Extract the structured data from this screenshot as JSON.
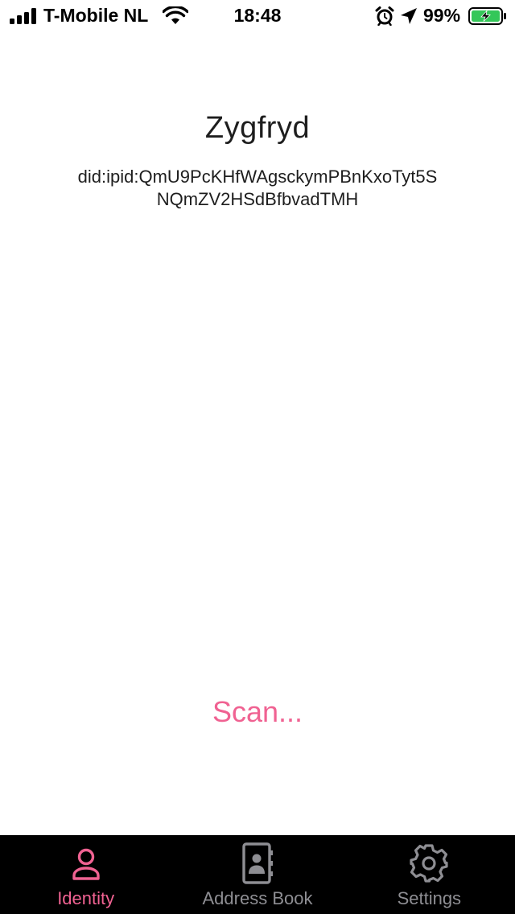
{
  "status_bar": {
    "carrier": "T-Mobile NL",
    "time": "18:48",
    "battery_percent": "99%",
    "icons": [
      "signal-icon",
      "wifi-icon",
      "alarm-icon",
      "location-arrow-icon",
      "battery-charging-icon"
    ]
  },
  "identity": {
    "name": "Zygfryd",
    "did_line1": "did:ipid:QmU9PcKHfWAgsckymPBnKxoTyt5S",
    "did_line2": "NQmZV2HSdBfbvadTMH"
  },
  "actions": {
    "scan_label": "Scan..."
  },
  "tab_bar": {
    "tabs": [
      {
        "label": "Identity",
        "icon": "person-icon",
        "active": true
      },
      {
        "label": "Address Book",
        "icon": "address-book-icon",
        "active": false
      },
      {
        "label": "Settings",
        "icon": "gear-icon",
        "active": false
      }
    ]
  },
  "colors": {
    "accent": "#f06292",
    "tab_bar_background": "#000000",
    "tab_inactive": "#8e8e93",
    "battery_fill": "#34c759"
  }
}
